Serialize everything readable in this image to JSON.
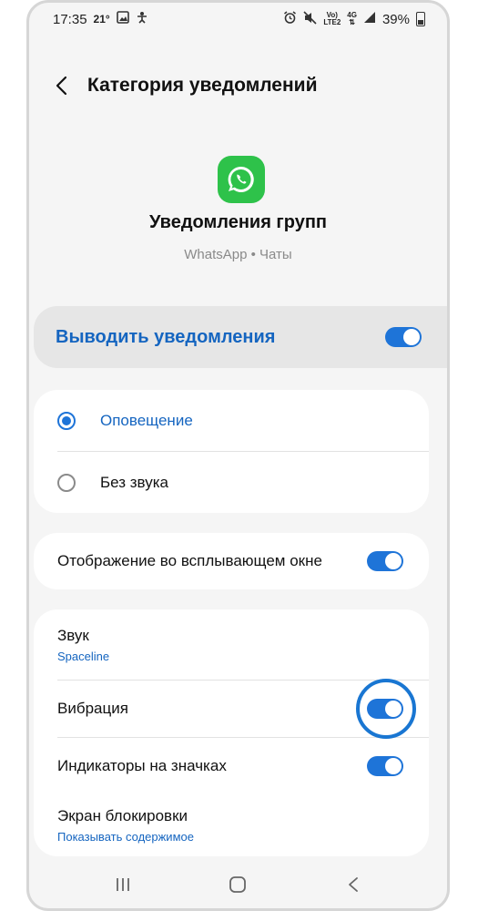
{
  "status_bar": {
    "time": "17:35",
    "temp": "21°",
    "network_top": "Vo)",
    "network_bottom": "LTE2",
    "gen": "4G",
    "battery": "39%"
  },
  "header": {
    "title": "Категория уведомлений"
  },
  "app": {
    "icon": "whatsapp-icon",
    "title": "Уведомления групп",
    "subtitle": "WhatsApp • Чаты"
  },
  "master_toggle": {
    "label": "Выводить уведомления",
    "on": true
  },
  "alert_mode": {
    "options": [
      {
        "label": "Оповещение",
        "selected": true
      },
      {
        "label": "Без звука",
        "selected": false
      }
    ]
  },
  "popup": {
    "label": "Отображение во всплывающем окне",
    "on": true
  },
  "settings": {
    "sound": {
      "label": "Звук",
      "value": "Spaceline"
    },
    "vibration": {
      "label": "Вибрация",
      "on": true,
      "highlighted": true
    },
    "badges": {
      "label": "Индикаторы на значках",
      "on": true
    },
    "lock_screen": {
      "label": "Экран блокировки",
      "value": "Показывать содержимое"
    }
  },
  "colors": {
    "accent": "#1e74d8",
    "link_blue": "#1565c0",
    "highlight": "#1976d2",
    "whatsapp_green": "#2ec24a"
  },
  "navbar": {
    "icons": [
      "recents-icon",
      "home-icon",
      "back-nav-icon"
    ]
  }
}
